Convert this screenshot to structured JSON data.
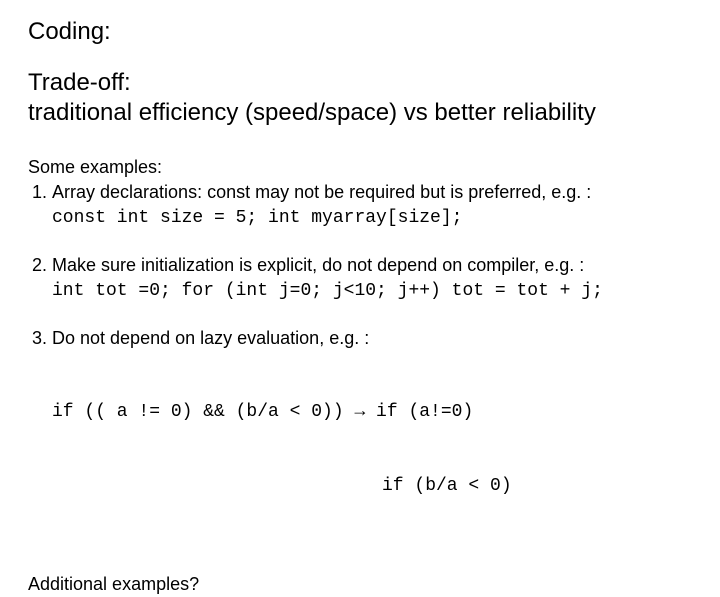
{
  "title": "Coding:",
  "subtitle_line1": "Trade-off:",
  "subtitle_line2": "traditional efficiency (speed/space) vs better reliability",
  "examples_header": "Some examples:",
  "items": [
    {
      "text": "Array declarations: const may not be required but is preferred, e.g. :",
      "code": "const int size = 5; int myarray[size];"
    },
    {
      "text": "Make sure initialization is explicit, do not depend on compiler, e.g. :",
      "code": "int tot =0; for (int j=0; j<10; j++) tot = tot + j;"
    },
    {
      "text": "Do not depend on lazy evaluation, e.g. :",
      "code_line1": "if (( a != 0) && (b/a < 0)) → if (a!=0)",
      "code_line2": "if (b/a < 0)"
    }
  ],
  "footer": "Additional examples?"
}
